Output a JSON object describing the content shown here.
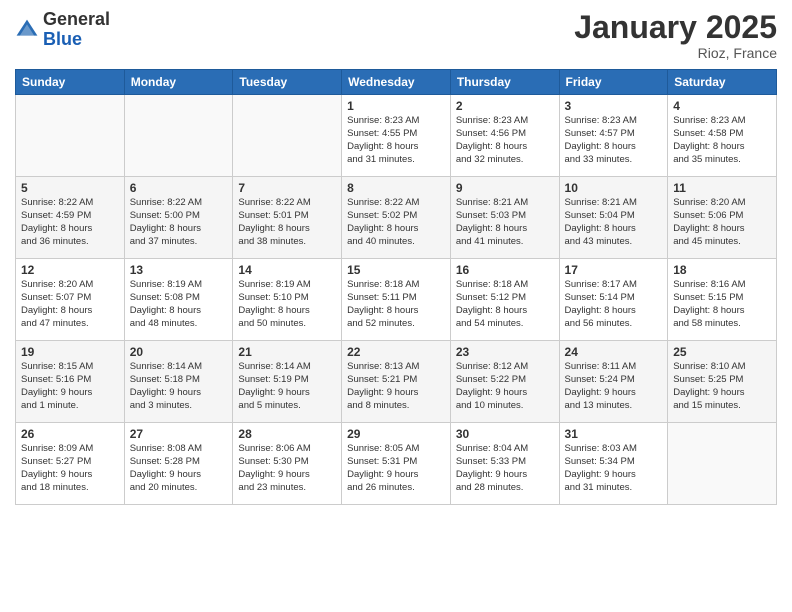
{
  "header": {
    "logo_general": "General",
    "logo_blue": "Blue",
    "month_title": "January 2025",
    "subtitle": "Rioz, France"
  },
  "days_of_week": [
    "Sunday",
    "Monday",
    "Tuesday",
    "Wednesday",
    "Thursday",
    "Friday",
    "Saturday"
  ],
  "weeks": [
    {
      "row_class": "row-1",
      "days": [
        {
          "num": "",
          "info": ""
        },
        {
          "num": "",
          "info": ""
        },
        {
          "num": "",
          "info": ""
        },
        {
          "num": "1",
          "info": "Sunrise: 8:23 AM\nSunset: 4:55 PM\nDaylight: 8 hours\nand 31 minutes."
        },
        {
          "num": "2",
          "info": "Sunrise: 8:23 AM\nSunset: 4:56 PM\nDaylight: 8 hours\nand 32 minutes."
        },
        {
          "num": "3",
          "info": "Sunrise: 8:23 AM\nSunset: 4:57 PM\nDaylight: 8 hours\nand 33 minutes."
        },
        {
          "num": "4",
          "info": "Sunrise: 8:23 AM\nSunset: 4:58 PM\nDaylight: 8 hours\nand 35 minutes."
        }
      ]
    },
    {
      "row_class": "row-2",
      "days": [
        {
          "num": "5",
          "info": "Sunrise: 8:22 AM\nSunset: 4:59 PM\nDaylight: 8 hours\nand 36 minutes."
        },
        {
          "num": "6",
          "info": "Sunrise: 8:22 AM\nSunset: 5:00 PM\nDaylight: 8 hours\nand 37 minutes."
        },
        {
          "num": "7",
          "info": "Sunrise: 8:22 AM\nSunset: 5:01 PM\nDaylight: 8 hours\nand 38 minutes."
        },
        {
          "num": "8",
          "info": "Sunrise: 8:22 AM\nSunset: 5:02 PM\nDaylight: 8 hours\nand 40 minutes."
        },
        {
          "num": "9",
          "info": "Sunrise: 8:21 AM\nSunset: 5:03 PM\nDaylight: 8 hours\nand 41 minutes."
        },
        {
          "num": "10",
          "info": "Sunrise: 8:21 AM\nSunset: 5:04 PM\nDaylight: 8 hours\nand 43 minutes."
        },
        {
          "num": "11",
          "info": "Sunrise: 8:20 AM\nSunset: 5:06 PM\nDaylight: 8 hours\nand 45 minutes."
        }
      ]
    },
    {
      "row_class": "row-3",
      "days": [
        {
          "num": "12",
          "info": "Sunrise: 8:20 AM\nSunset: 5:07 PM\nDaylight: 8 hours\nand 47 minutes."
        },
        {
          "num": "13",
          "info": "Sunrise: 8:19 AM\nSunset: 5:08 PM\nDaylight: 8 hours\nand 48 minutes."
        },
        {
          "num": "14",
          "info": "Sunrise: 8:19 AM\nSunset: 5:10 PM\nDaylight: 8 hours\nand 50 minutes."
        },
        {
          "num": "15",
          "info": "Sunrise: 8:18 AM\nSunset: 5:11 PM\nDaylight: 8 hours\nand 52 minutes."
        },
        {
          "num": "16",
          "info": "Sunrise: 8:18 AM\nSunset: 5:12 PM\nDaylight: 8 hours\nand 54 minutes."
        },
        {
          "num": "17",
          "info": "Sunrise: 8:17 AM\nSunset: 5:14 PM\nDaylight: 8 hours\nand 56 minutes."
        },
        {
          "num": "18",
          "info": "Sunrise: 8:16 AM\nSunset: 5:15 PM\nDaylight: 8 hours\nand 58 minutes."
        }
      ]
    },
    {
      "row_class": "row-4",
      "days": [
        {
          "num": "19",
          "info": "Sunrise: 8:15 AM\nSunset: 5:16 PM\nDaylight: 9 hours\nand 1 minute."
        },
        {
          "num": "20",
          "info": "Sunrise: 8:14 AM\nSunset: 5:18 PM\nDaylight: 9 hours\nand 3 minutes."
        },
        {
          "num": "21",
          "info": "Sunrise: 8:14 AM\nSunset: 5:19 PM\nDaylight: 9 hours\nand 5 minutes."
        },
        {
          "num": "22",
          "info": "Sunrise: 8:13 AM\nSunset: 5:21 PM\nDaylight: 9 hours\nand 8 minutes."
        },
        {
          "num": "23",
          "info": "Sunrise: 8:12 AM\nSunset: 5:22 PM\nDaylight: 9 hours\nand 10 minutes."
        },
        {
          "num": "24",
          "info": "Sunrise: 8:11 AM\nSunset: 5:24 PM\nDaylight: 9 hours\nand 13 minutes."
        },
        {
          "num": "25",
          "info": "Sunrise: 8:10 AM\nSunset: 5:25 PM\nDaylight: 9 hours\nand 15 minutes."
        }
      ]
    },
    {
      "row_class": "row-5",
      "days": [
        {
          "num": "26",
          "info": "Sunrise: 8:09 AM\nSunset: 5:27 PM\nDaylight: 9 hours\nand 18 minutes."
        },
        {
          "num": "27",
          "info": "Sunrise: 8:08 AM\nSunset: 5:28 PM\nDaylight: 9 hours\nand 20 minutes."
        },
        {
          "num": "28",
          "info": "Sunrise: 8:06 AM\nSunset: 5:30 PM\nDaylight: 9 hours\nand 23 minutes."
        },
        {
          "num": "29",
          "info": "Sunrise: 8:05 AM\nSunset: 5:31 PM\nDaylight: 9 hours\nand 26 minutes."
        },
        {
          "num": "30",
          "info": "Sunrise: 8:04 AM\nSunset: 5:33 PM\nDaylight: 9 hours\nand 28 minutes."
        },
        {
          "num": "31",
          "info": "Sunrise: 8:03 AM\nSunset: 5:34 PM\nDaylight: 9 hours\nand 31 minutes."
        },
        {
          "num": "",
          "info": ""
        }
      ]
    }
  ]
}
